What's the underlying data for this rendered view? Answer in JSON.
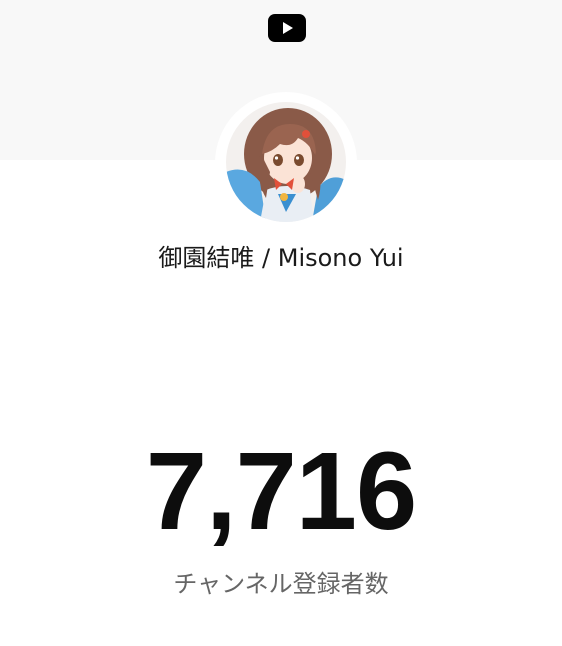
{
  "header": {
    "logo_icon": "youtube-play-icon"
  },
  "channel": {
    "avatar_icon": "channel-avatar-illustration",
    "name": "御園結唯 / Misono Yui"
  },
  "stats": {
    "subscriber_count": "7,716",
    "subscriber_label": "チャンネル登録者数"
  },
  "colors": {
    "banner_bg": "#f8f8f8",
    "count_text": "#0d0d0d",
    "label_text": "#666666",
    "logo_bg": "#000000"
  }
}
